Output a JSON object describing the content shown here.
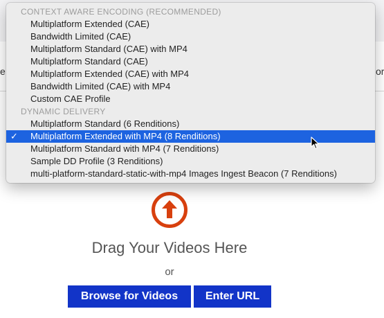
{
  "background": {
    "left_edge_text": "e",
    "right_edge_text": "or"
  },
  "dropdown": {
    "groups": [
      {
        "label": "CONTEXT AWARE ENCODING (RECOMMENDED)",
        "options": [
          "Multiplatform Extended (CAE)",
          "Bandwidth Limited (CAE)",
          "Multiplatform Standard (CAE) with MP4",
          "Multiplatform Standard (CAE)",
          "Multiplatform Extended (CAE) with MP4",
          "Bandwidth Limited (CAE) with MP4",
          "Custom CAE Profile"
        ]
      },
      {
        "label": "DYNAMIC DELIVERY",
        "options": [
          "Multiplatform Standard (6 Renditions)",
          "Multiplatform Extended with MP4 (8 Renditions)",
          "Multiplatform Standard with MP4 (7 Renditions)",
          "Sample DD Profile (3 Renditions)",
          "multi-platform-standard-static-with-mp4 Images Ingest Beacon (7 Renditions)"
        ]
      }
    ],
    "selected": "Multiplatform Extended with MP4 (8 Renditions)",
    "check_glyph": "✓",
    "selected_color": "#1d63e0"
  },
  "upload": {
    "icon": "upload-arrow-icon",
    "icon_color": "#d8400e",
    "title": "Drag Your Videos Here",
    "or_text": "or",
    "browse_label": "Browse for Videos",
    "url_label": "Enter URL",
    "button_color": "#1234c8"
  }
}
